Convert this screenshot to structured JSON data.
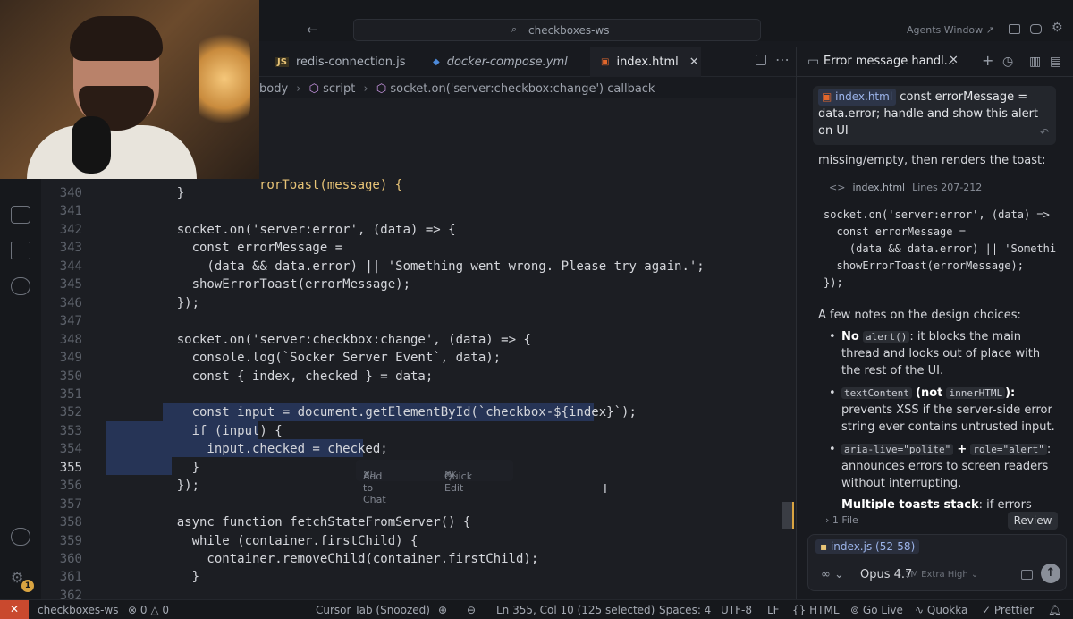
{
  "titlebar": {
    "search_placeholder": "checkboxes-ws",
    "agents_window": "Agents Window"
  },
  "tabs": [
    {
      "label": "redis-connection.js",
      "icon": "JS"
    },
    {
      "label": "docker-compose.yml",
      "icon": "docker"
    },
    {
      "label": "index.html",
      "icon": "html5",
      "active": true
    }
  ],
  "breadcrumb": [
    "body",
    "script",
    "socket.on('server:checkbox:change') callback"
  ],
  "editor": {
    "partial_line": "rorToast(message) {",
    "lines": [
      {
        "n": "340",
        "code": "    }"
      },
      {
        "n": "341",
        "code": ""
      },
      {
        "n": "342",
        "code": "    socket.on('server:error', (data) => {"
      },
      {
        "n": "343",
        "code": "      const errorMessage ="
      },
      {
        "n": "344",
        "code": "        (data && data.error) || 'Something went wrong. Please try again.';"
      },
      {
        "n": "345",
        "code": "      showErrorToast(errorMessage);"
      },
      {
        "n": "346",
        "code": "    });"
      },
      {
        "n": "347",
        "code": ""
      },
      {
        "n": "348",
        "code": "    socket.on('server:checkbox:change', (data) => {"
      },
      {
        "n": "349",
        "code": "      console.log(`Socker Server Event`, data);"
      },
      {
        "n": "350",
        "code": "      const { index, checked } = data;"
      },
      {
        "n": "351",
        "code": ""
      },
      {
        "n": "352",
        "code": "      const input = document.getElementById(`checkbox-${index}`);"
      },
      {
        "n": "353",
        "code": "      if (input) {"
      },
      {
        "n": "354",
        "code": "        input.checked = checked;"
      },
      {
        "n": "355",
        "code": "      }"
      },
      {
        "n": "356",
        "code": "    });"
      },
      {
        "n": "357",
        "code": ""
      },
      {
        "n": "358",
        "code": "    async function fetchStateFromServer() {"
      },
      {
        "n": "359",
        "code": "      while (container.firstChild) {"
      },
      {
        "n": "360",
        "code": "        container.removeChild(container.firstChild);"
      },
      {
        "n": "361",
        "code": "      }"
      },
      {
        "n": "362",
        "code": ""
      }
    ],
    "peek_add_to_chat": "Add to Chat",
    "peek_add_to_chat_key": "⌘L",
    "peek_quick_edit": "Quick Edit",
    "peek_quick_edit_key": "⌘K"
  },
  "chat": {
    "title": "Error message handl...",
    "user_message_file": "index.html",
    "user_message_text": "const errorMessage = data.error; handle and show this alert on UI",
    "intro_tail": "missing/empty, then renders the toast:",
    "code_ref_file": "index.html",
    "code_ref_lines": "Lines 207-212",
    "code_block": "socket.on('server:error', (data) =>\n  const errorMessage =\n    (data && data.error) || 'Somethi\n  showErrorToast(errorMessage);\n});",
    "notes_intro": "A few notes on the design choices:",
    "note1_bold": "No",
    "note1_code": "alert()",
    "note1_text": ": it blocks the main thread and looks out of place with the rest of the UI.",
    "note2_code1": "textContent",
    "note2_not": "(not",
    "note2_code2": "innerHTML",
    "note2_close": "):",
    "note2_text": "prevents XSS if the server-side error string ever contains untrusted input.",
    "note3_code1": "aria-live=\"polite\"",
    "note3_plus": "+",
    "note3_code2": "role=\"alert\"",
    "note3_text": ": announces errors to screen readers without interrupting.",
    "note4_bold": "Multiple toasts stack",
    "note4_text": ": if errors come in",
    "file_summary": "1 File",
    "review": "Review",
    "context_chip": "index.js (52-58)",
    "model_name": "Opus 4.7",
    "model_variant": "1M Extra High"
  },
  "statusbar": {
    "remote": "✕",
    "workspace": "checkboxes-ws",
    "errors": "0",
    "warnings": "0",
    "cursor_tab": "Cursor Tab (Snoozed)",
    "position": "Ln 355, Col 10 (125 selected)",
    "spaces": "Spaces: 4",
    "encoding": "UTF-8",
    "eol": "LF",
    "language": "HTML",
    "go_live": "Go Live",
    "quokka": "Quokka",
    "prettier": "Prettier",
    "notifications": "1"
  }
}
